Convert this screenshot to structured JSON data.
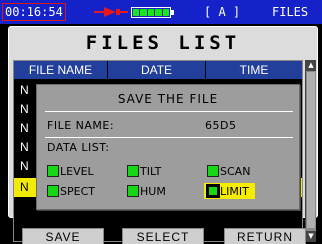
{
  "status_bar": {
    "clock": "00:16:54",
    "mode": "[ A ]",
    "screen_name": "FILES",
    "battery_level": 1.0,
    "icons": [
      "usb-cable-icon",
      "battery-icon"
    ],
    "colors": {
      "bar": "#1521c9",
      "battery": "#18e818",
      "cable": "#e81818"
    }
  },
  "window": {
    "title": "FILES LIST",
    "columns": [
      "FILE NAME",
      "DATE",
      "TIME"
    ],
    "rows": [
      "N",
      "N",
      "N",
      "N",
      "N",
      "N"
    ],
    "selected_row_index": 5,
    "highlight_color": "#f2ea07"
  },
  "dialog": {
    "title": "SAVE THE FILE",
    "file_name_label": "FILE NAME:",
    "file_name_value": "65D5",
    "data_list_label": "DATA LIST:",
    "options": [
      {
        "label": "LEVEL",
        "checked": false
      },
      {
        "label": "TILT",
        "checked": false
      },
      {
        "label": "SCAN",
        "checked": false
      },
      {
        "label": "SPECT",
        "checked": false
      },
      {
        "label": "HUM",
        "checked": false
      },
      {
        "label": "LIMIT",
        "checked": true
      }
    ]
  },
  "softkeys": [
    "SAVE",
    "SELECT",
    "RETURN"
  ]
}
